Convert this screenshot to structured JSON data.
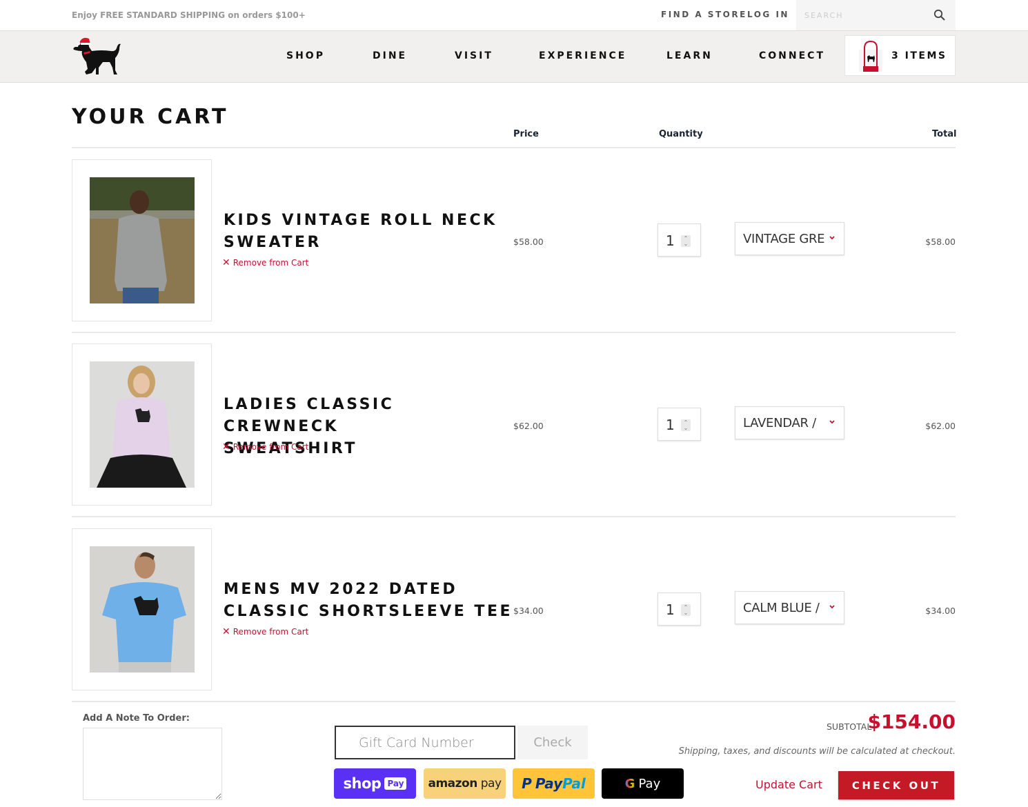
{
  "topbar": {
    "promo": "Enjoy FREE STANDARD SHIPPING on orders $100+",
    "find_store": "FIND A STORE",
    "log_in": "LOG IN",
    "search_placeholder": "SEARCH"
  },
  "nav": {
    "items": [
      "SHOP",
      "DINE",
      "VISIT",
      "EXPERIENCE",
      "LEARN",
      "CONNECT"
    ],
    "cart_label": "3 ITEMS"
  },
  "cart": {
    "title": "YOUR CART",
    "columns": {
      "price": "Price",
      "quantity": "Quantity",
      "total": "Total"
    },
    "remove_label": "Remove from Cart",
    "items": [
      {
        "name_line1": "KIDS VINTAGE ROLL NECK",
        "name_line2": "SWEATER",
        "price": "$58.00",
        "quantity": "1",
        "variant": "VINTAGE GRE",
        "total": "$58.00",
        "image": "kid-gray-sweater-photo"
      },
      {
        "name_line1": "LADIES CLASSIC CREWNECK",
        "name_line2": "SWEATSHIRT",
        "price": "$62.00",
        "quantity": "1",
        "variant": "LAVENDAR /",
        "total": "$62.00",
        "image": "woman-lavender-sweatshirt-photo"
      },
      {
        "name_line1": "MENS MV 2022 DATED",
        "name_line2": "CLASSIC SHORTSLEEVE TEE",
        "price": "$34.00",
        "quantity": "1",
        "variant": "CALM BLUE /",
        "total": "$34.00",
        "image": "man-blue-tee-photo"
      }
    ]
  },
  "footer": {
    "note_label": "Add A Note To Order:",
    "note_value": "",
    "gift_placeholder": "Gift Card Number",
    "check_label": "Check",
    "payments": {
      "shop_pay": {
        "word": "shop",
        "badge": "Pay"
      },
      "amazon_pay": {
        "word1": "amazon",
        "word2": "pay"
      },
      "paypal": {
        "word1": "Pay",
        "word2": "Pal"
      },
      "gpay": {
        "g": "G",
        "word": "Pay"
      }
    },
    "subtotal_label": "SUBTOTAL",
    "subtotal_value": "$154.00",
    "shipping_note": "Shipping, taxes, and discounts will be calculated at checkout.",
    "update_cart": "Update Cart",
    "checkout": "CHECK OUT"
  },
  "colors": {
    "accent_red": "#c8102e",
    "checkout_red": "#c41a25",
    "shop_pay_purple": "#5a31f4",
    "amazon_yellow": "#f8d27a",
    "paypal_yellow": "#ffc43a"
  }
}
